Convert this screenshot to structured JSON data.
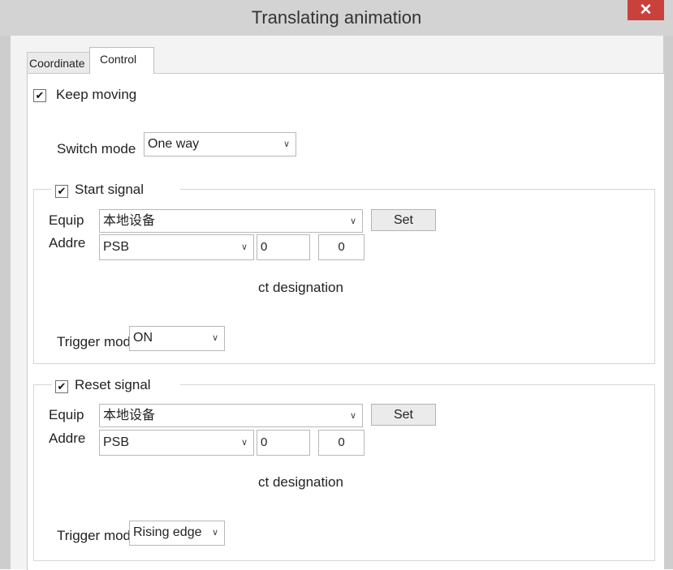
{
  "window": {
    "title": "Translating animation",
    "close_glyph": "✕"
  },
  "tabs": [
    {
      "label": "Coordinate",
      "active": false
    },
    {
      "label": "Control",
      "active": true
    }
  ],
  "keep_moving": {
    "label": "Keep moving",
    "checked": true
  },
  "switch_mode": {
    "label": "Switch mode",
    "value": "One way"
  },
  "start_signal": {
    "label": "Start signal",
    "checked": true,
    "equip_label": "Equip",
    "equip_value": "本地设备",
    "set_label": "Set",
    "addr_label": "Addre",
    "addr_type": "PSB",
    "addr_value1": "0",
    "addr_value2": "0",
    "designation": "ct designation",
    "trigger_label": "Trigger mode",
    "trigger_value": "ON"
  },
  "reset_signal": {
    "label": "Reset signal",
    "checked": true,
    "equip_label": "Equip",
    "equip_value": "本地设备",
    "set_label": "Set",
    "addr_label": "Addre",
    "addr_type": "PSB",
    "addr_value1": "0",
    "addr_value2": "0",
    "designation": "ct designation",
    "trigger_label": "Trigger mode",
    "trigger_value": "Rising edge"
  },
  "icons": {
    "check": "✔",
    "dropdown": "chevron-down-icon"
  },
  "colors": {
    "titlebar": "#d3d3d3",
    "close_button": "#c9413b",
    "dialog_bg": "#f3f3f3",
    "panel_bg": "#ffffff"
  }
}
